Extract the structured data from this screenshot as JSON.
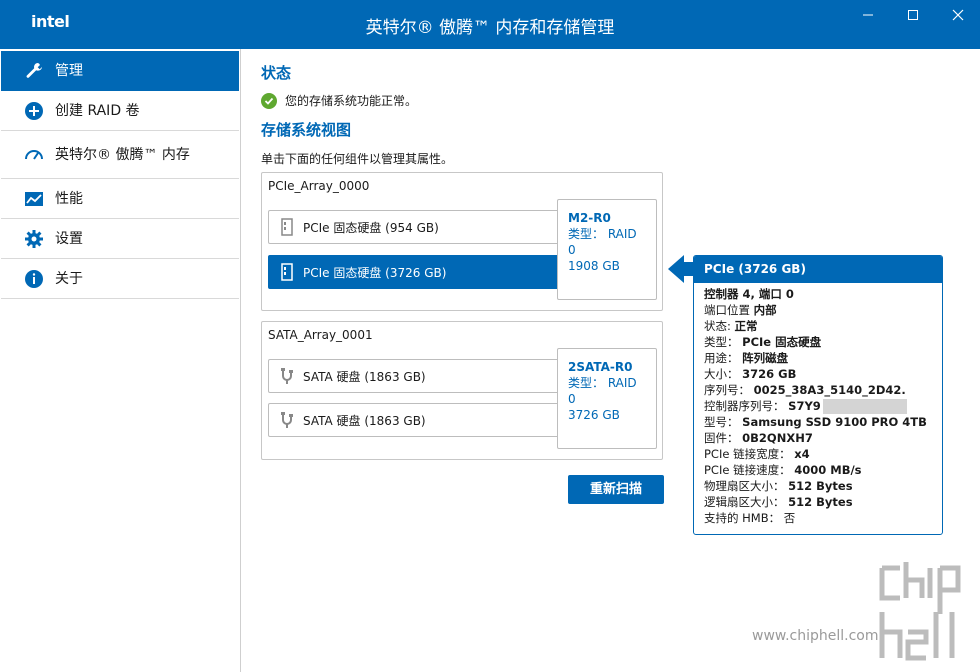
{
  "titlebar": {
    "logo": "intel",
    "title": "英特尔® 傲腾™ 内存和存储管理",
    "minimize": "—",
    "maximize": "☐",
    "close": "✕"
  },
  "sidebar": {
    "items": [
      {
        "label": "管理",
        "icon": "wrench-icon"
      },
      {
        "label": "创建 RAID 卷",
        "icon": "plus-circle-icon"
      },
      {
        "label": "英特尔® 傲腾™ 内存",
        "icon": "gauge-icon"
      },
      {
        "label": "性能",
        "icon": "chart-icon"
      },
      {
        "label": "设置",
        "icon": "gear-icon"
      },
      {
        "label": "关于",
        "icon": "info-icon"
      }
    ]
  },
  "main": {
    "status_heading": "状态",
    "status_text": "您的存储系统功能正常。",
    "view_heading": "存储系统视图",
    "hint": "单击下面的任何组件以管理其属性。",
    "arrays": [
      {
        "name": "PCIe_Array_0000",
        "disks": [
          "PCIe 固态硬盘 (954 GB)",
          "PCIe 固态硬盘 (3726 GB)"
        ],
        "raid": {
          "name": "M2-R0",
          "type": "类型： RAID 0",
          "size": "1908 GB"
        }
      },
      {
        "name": "SATA_Array_0001",
        "disks": [
          "SATA 硬盘 (1863 GB)",
          "SATA 硬盘 (1863 GB)"
        ],
        "raid": {
          "name": "2SATA-R0",
          "type": "类型： RAID 0",
          "size": "3726 GB"
        }
      }
    ],
    "rescan_label": "重新扫描"
  },
  "detail": {
    "title": "PCIe (3726 GB)",
    "rows": [
      {
        "k": "控制器 4, 端口 0",
        "v": ""
      },
      {
        "k": "端口位置 ",
        "v": "内部"
      },
      {
        "k": "状态: ",
        "v": "正常"
      },
      {
        "k": "类型： ",
        "v": "PCIe 固态硬盘"
      },
      {
        "k": "用途： ",
        "v": "阵列磁盘"
      },
      {
        "k": "大小： ",
        "v": "3726 GB"
      },
      {
        "k": "序列号： ",
        "v": "0025_38A3_5140_2D42."
      },
      {
        "k": "控制器序列号： ",
        "v": "S7Y9"
      },
      {
        "k": "型号： ",
        "v": "Samsung SSD 9100 PRO 4TB"
      },
      {
        "k": "固件： ",
        "v": "0B2QNXH7"
      },
      {
        "k": "PCIe 链接宽度： ",
        "v": "x4"
      },
      {
        "k": "PCIe 链接速度： ",
        "v": "4000 MB/s"
      },
      {
        "k": "物理扇区大小： ",
        "v": "512 Bytes"
      },
      {
        "k": "逻辑扇区大小： ",
        "v": "512 Bytes"
      },
      {
        "k": "支持的 HMB： ",
        "v": "否"
      }
    ]
  },
  "watermark": {
    "text": "www.chiphell.com",
    "logo_text": "chip hell"
  },
  "colors": {
    "accent": "#0068b5",
    "ok": "#5fa830"
  }
}
